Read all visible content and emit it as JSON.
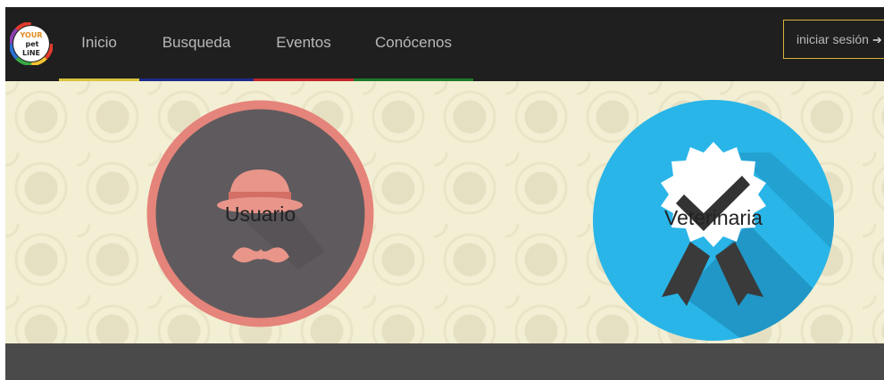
{
  "brand": {
    "logo_lines": [
      "YOUR",
      "pet",
      "LiNE"
    ]
  },
  "nav": {
    "items": [
      {
        "label": "Inicio",
        "color": "#d8c33a"
      },
      {
        "label": "Busqueda",
        "color": "#1d2a8c"
      },
      {
        "label": "Eventos",
        "color": "#c0262a"
      },
      {
        "label": "Conócenos",
        "color": "#1f7a2b"
      }
    ],
    "login_label": "iniciar sesión",
    "login_icon": "sign-in-icon"
  },
  "cards": {
    "usuario": {
      "label": "Usuario",
      "icon": "hat-mustache-icon",
      "ring_color": "#e5847a",
      "fill_color": "#5f5a5d"
    },
    "veterinaria": {
      "label": "Veterinaria",
      "icon": "certified-badge-icon",
      "fill_color": "#29b5e8"
    }
  }
}
